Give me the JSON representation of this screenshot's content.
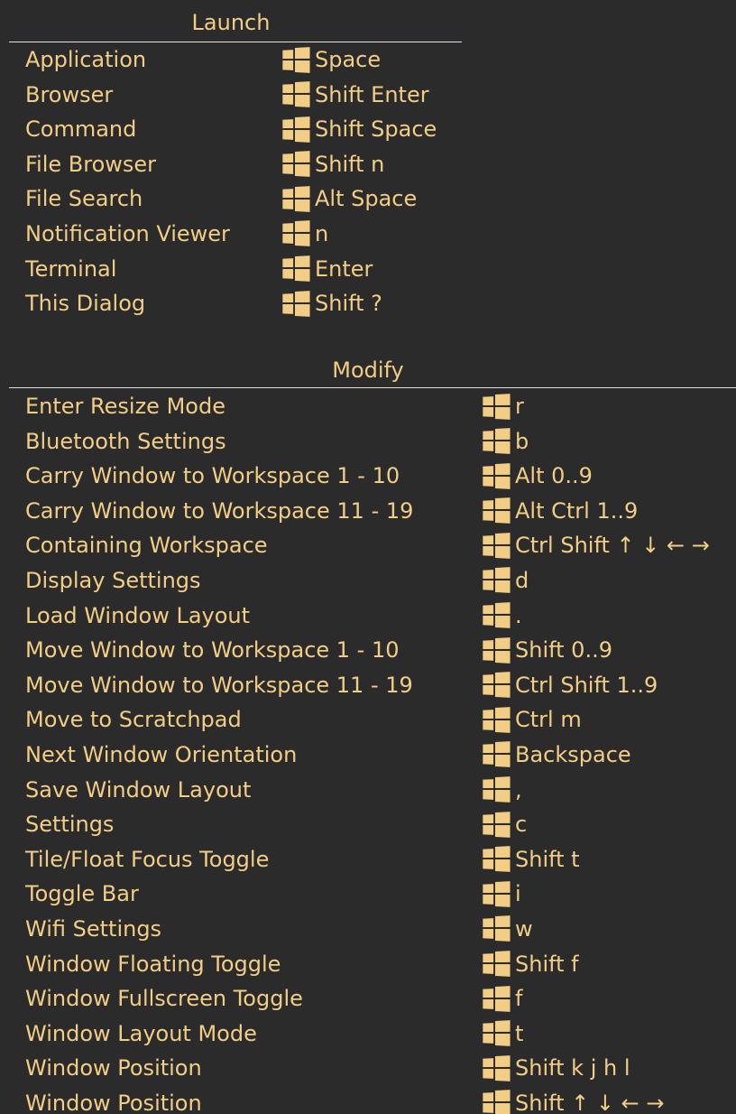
{
  "colors": {
    "background": "#2b2b2b",
    "text": "#f2cd86",
    "rule": "#e8e2d6"
  },
  "icons": {
    "modifier": "windows-logo-icon"
  },
  "launch": {
    "title": "Launch",
    "rows": [
      {
        "action": "Application",
        "keys": "Space"
      },
      {
        "action": "Browser",
        "keys": "Shift Enter"
      },
      {
        "action": "Command",
        "keys": "Shift Space"
      },
      {
        "action": "File Browser",
        "keys": "Shift n"
      },
      {
        "action": "File Search",
        "keys": "Alt Space"
      },
      {
        "action": "Notification Viewer",
        "keys": "n"
      },
      {
        "action": "Terminal",
        "keys": "Enter"
      },
      {
        "action": "This Dialog",
        "keys": "Shift ?"
      }
    ]
  },
  "modify": {
    "title": "Modify",
    "rows": [
      {
        "action": "Enter Resize Mode",
        "keys": "r"
      },
      {
        "action": "Bluetooth Settings",
        "keys": "b"
      },
      {
        "action": "Carry Window to Workspace 1 - 10",
        "keys": "Alt 0..9"
      },
      {
        "action": "Carry Window to Workspace 11 - 19",
        "keys": "Alt Ctrl 1..9"
      },
      {
        "action": "Containing Workspace",
        "keys": "Ctrl Shift ↑ ↓ ← →"
      },
      {
        "action": "Display Settings",
        "keys": "d"
      },
      {
        "action": "Load Window Layout",
        "keys": "."
      },
      {
        "action": "Move Window to Workspace 1 - 10",
        "keys": "Shift 0..9"
      },
      {
        "action": "Move Window to Workspace 11 - 19",
        "keys": "Ctrl Shift 1..9"
      },
      {
        "action": "Move to Scratchpad",
        "keys": "Ctrl m"
      },
      {
        "action": "Next Window Orientation",
        "keys": "Backspace"
      },
      {
        "action": "Save Window Layout",
        "keys": ","
      },
      {
        "action": "Settings",
        "keys": "c"
      },
      {
        "action": "Tile/Float Focus Toggle",
        "keys": "Shift t"
      },
      {
        "action": "Toggle Bar",
        "keys": "i"
      },
      {
        "action": "Wifi Settings",
        "keys": "w"
      },
      {
        "action": "Window Floating Toggle",
        "keys": "Shift f"
      },
      {
        "action": "Window Fullscreen Toggle",
        "keys": "f"
      },
      {
        "action": "Window Layout Mode",
        "keys": "t"
      },
      {
        "action": "Window Position",
        "keys": "Shift k j h l"
      },
      {
        "action": "Window Position",
        "keys": "Shift ↑ ↓ ← →"
      }
    ]
  }
}
